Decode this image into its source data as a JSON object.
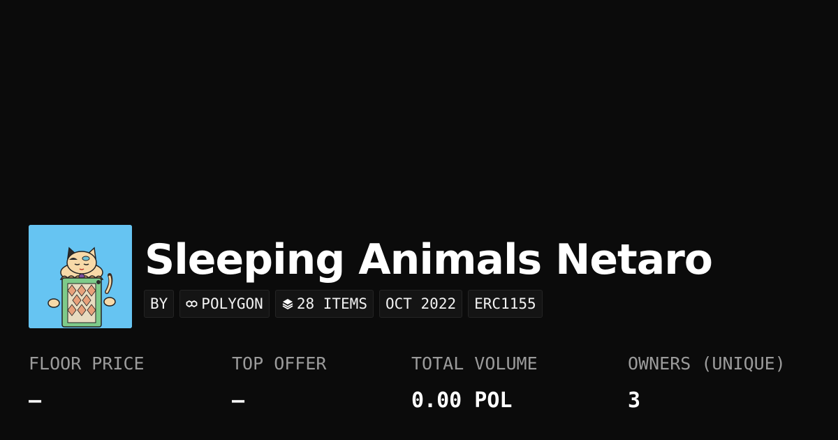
{
  "collection": {
    "title": "Sleeping Animals Netaro",
    "avatar_bg": "#66c4f2"
  },
  "tags": {
    "by": "BY",
    "chain": {
      "label": "POLYGON",
      "icon": "polygon-icon"
    },
    "items": {
      "label": "28 ITEMS",
      "icon": "layers-icon"
    },
    "date": "OCT 2022",
    "standard": "ERC1155"
  },
  "stats": [
    {
      "label": "FLOOR PRICE",
      "value": "–"
    },
    {
      "label": "TOP OFFER",
      "value": "–"
    },
    {
      "label": "TOTAL VOLUME",
      "value": "0.00 POL"
    },
    {
      "label": "OWNERS (UNIQUE)",
      "value": "3"
    }
  ]
}
